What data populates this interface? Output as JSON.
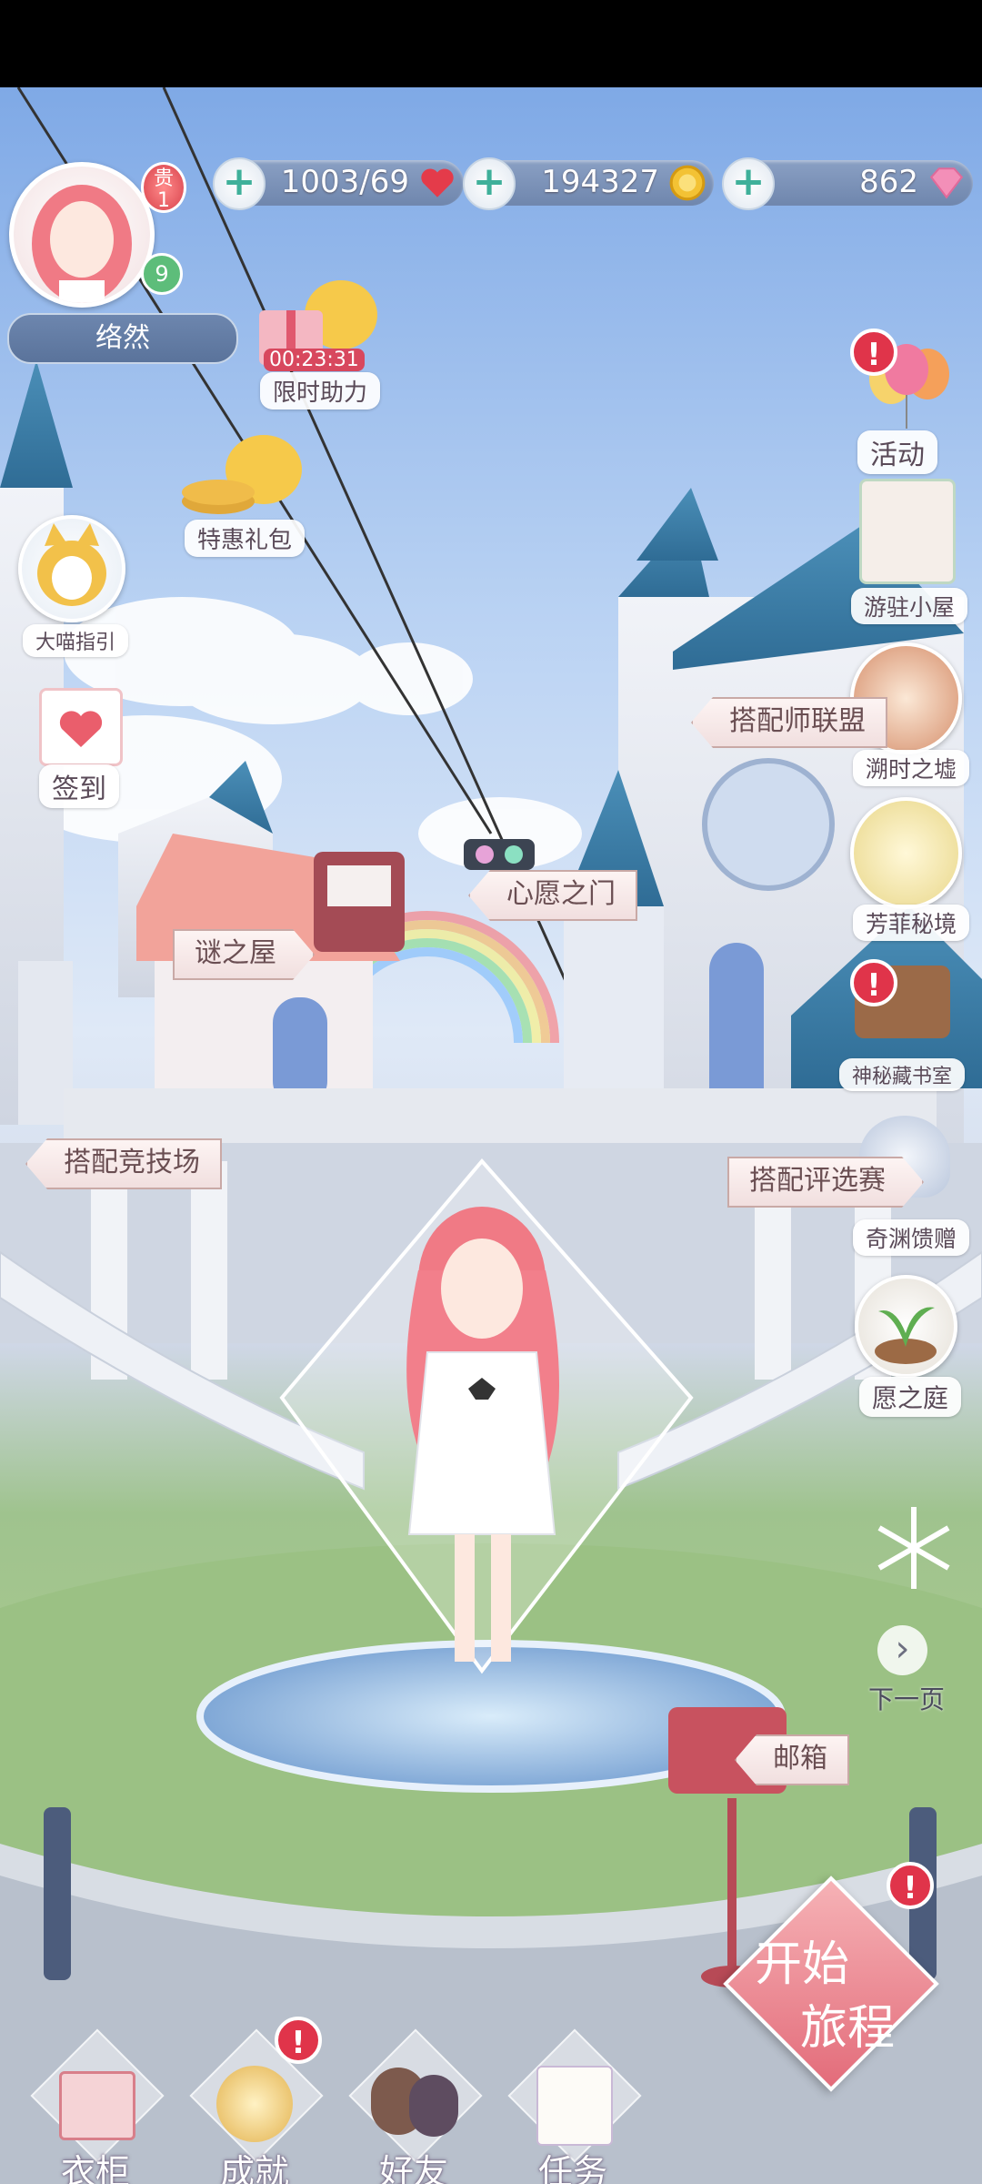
{
  "player": {
    "name": "络然",
    "level": "9",
    "rank_badge": "贵\n1"
  },
  "resources": {
    "stamina": "1003/69",
    "gold": "194327",
    "diamonds": "862"
  },
  "events": {
    "limited_help_timer": "00:23:31",
    "limited_help_label": "限时助力",
    "special_pack_label": "特惠礼包",
    "cat_guide_label": "大喵指引",
    "checkin_label": "签到"
  },
  "right_menu": [
    {
      "label": "活动"
    },
    {
      "label": "游驻小屋"
    },
    {
      "label": "溯时之墟"
    },
    {
      "label": "芳菲秘境"
    },
    {
      "label": "神秘藏书室"
    },
    {
      "label": "奇渊馈赠"
    },
    {
      "label": "愿之庭"
    },
    {
      "label": "下一页"
    }
  ],
  "signposts": {
    "stylist_alliance": "搭配师联盟",
    "wish_gate": "心愿之门",
    "mystery_house": "谜之屋",
    "arena": "搭配竞技场",
    "review": "搭配评选赛",
    "mailbox": "邮箱"
  },
  "start": {
    "line1": "开始",
    "line2": "旅程"
  },
  "bottom_nav": [
    {
      "label": "衣柜"
    },
    {
      "label": "成就"
    },
    {
      "label": "好友"
    },
    {
      "label": "任务"
    }
  ],
  "colors": {
    "alert": "#e0344a",
    "start_button": "#e98790",
    "nav_label_glow": "#6b5a7a"
  }
}
